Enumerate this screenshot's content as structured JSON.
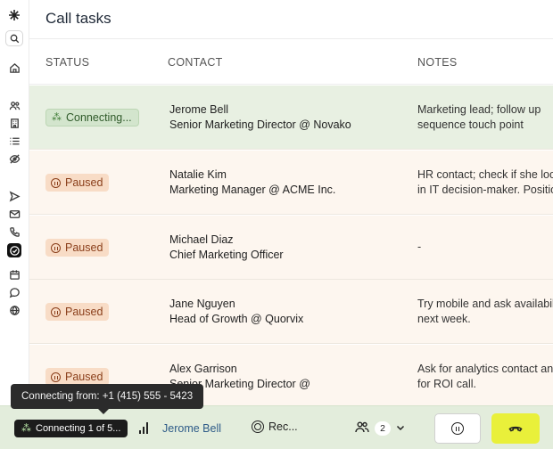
{
  "header": {
    "title": "Call tasks"
  },
  "columns": {
    "status": "STATUS",
    "contact": "CONTACT",
    "notes": "NOTES"
  },
  "rows": [
    {
      "status": "Connecting...",
      "name": "Jerome Bell",
      "title": "Senior Marketing Director @ Novako",
      "notes1": "Marketing lead; follow up",
      "notes2": "sequence touch point"
    },
    {
      "status": "Paused",
      "name": "Natalie Kim",
      "title": "Marketing Manager @ ACME Inc.",
      "notes1": "HR contact; check if she loo",
      "notes2": "in IT decision-maker. Positio"
    },
    {
      "status": "Paused",
      "name": "Michael Diaz",
      "title": "Chief Marketing Officer",
      "notes1": "-",
      "notes2": ""
    },
    {
      "status": "Paused",
      "name": "Jane Nguyen",
      "title": "Head of Growth @ Quorvix",
      "notes1": "Try mobile and ask availabili",
      "notes2": "next week."
    },
    {
      "status": "Paused",
      "name": "Alex Garrison",
      "title": "Senior Marketing Director @",
      "notes1": "Ask for analytics contact an",
      "notes2": "for ROI call."
    }
  ],
  "tooltip": {
    "text": "Connecting from: +1 (415) 555 - 5423"
  },
  "bottombar": {
    "status": "Connecting 1 of 5...",
    "contact_name": "Jerome Bell",
    "record_label": "Rec...",
    "participants_count": "2"
  },
  "icons": {
    "sidebar": [
      "logo-icon",
      "search-icon",
      "home-icon",
      "users-icon",
      "building-icon",
      "list-icon",
      "eye-icon",
      "send-icon",
      "mail-icon",
      "phone-icon",
      "check-circle-icon",
      "calendar-icon",
      "chat-icon",
      "globe-icon"
    ]
  },
  "colors": {
    "active_row": "#e8f0e2",
    "paused_row": "#fdf6ef",
    "paused_badge": "#f8dcc6",
    "hangup": "#e9f03a",
    "link": "#2e5b88"
  }
}
